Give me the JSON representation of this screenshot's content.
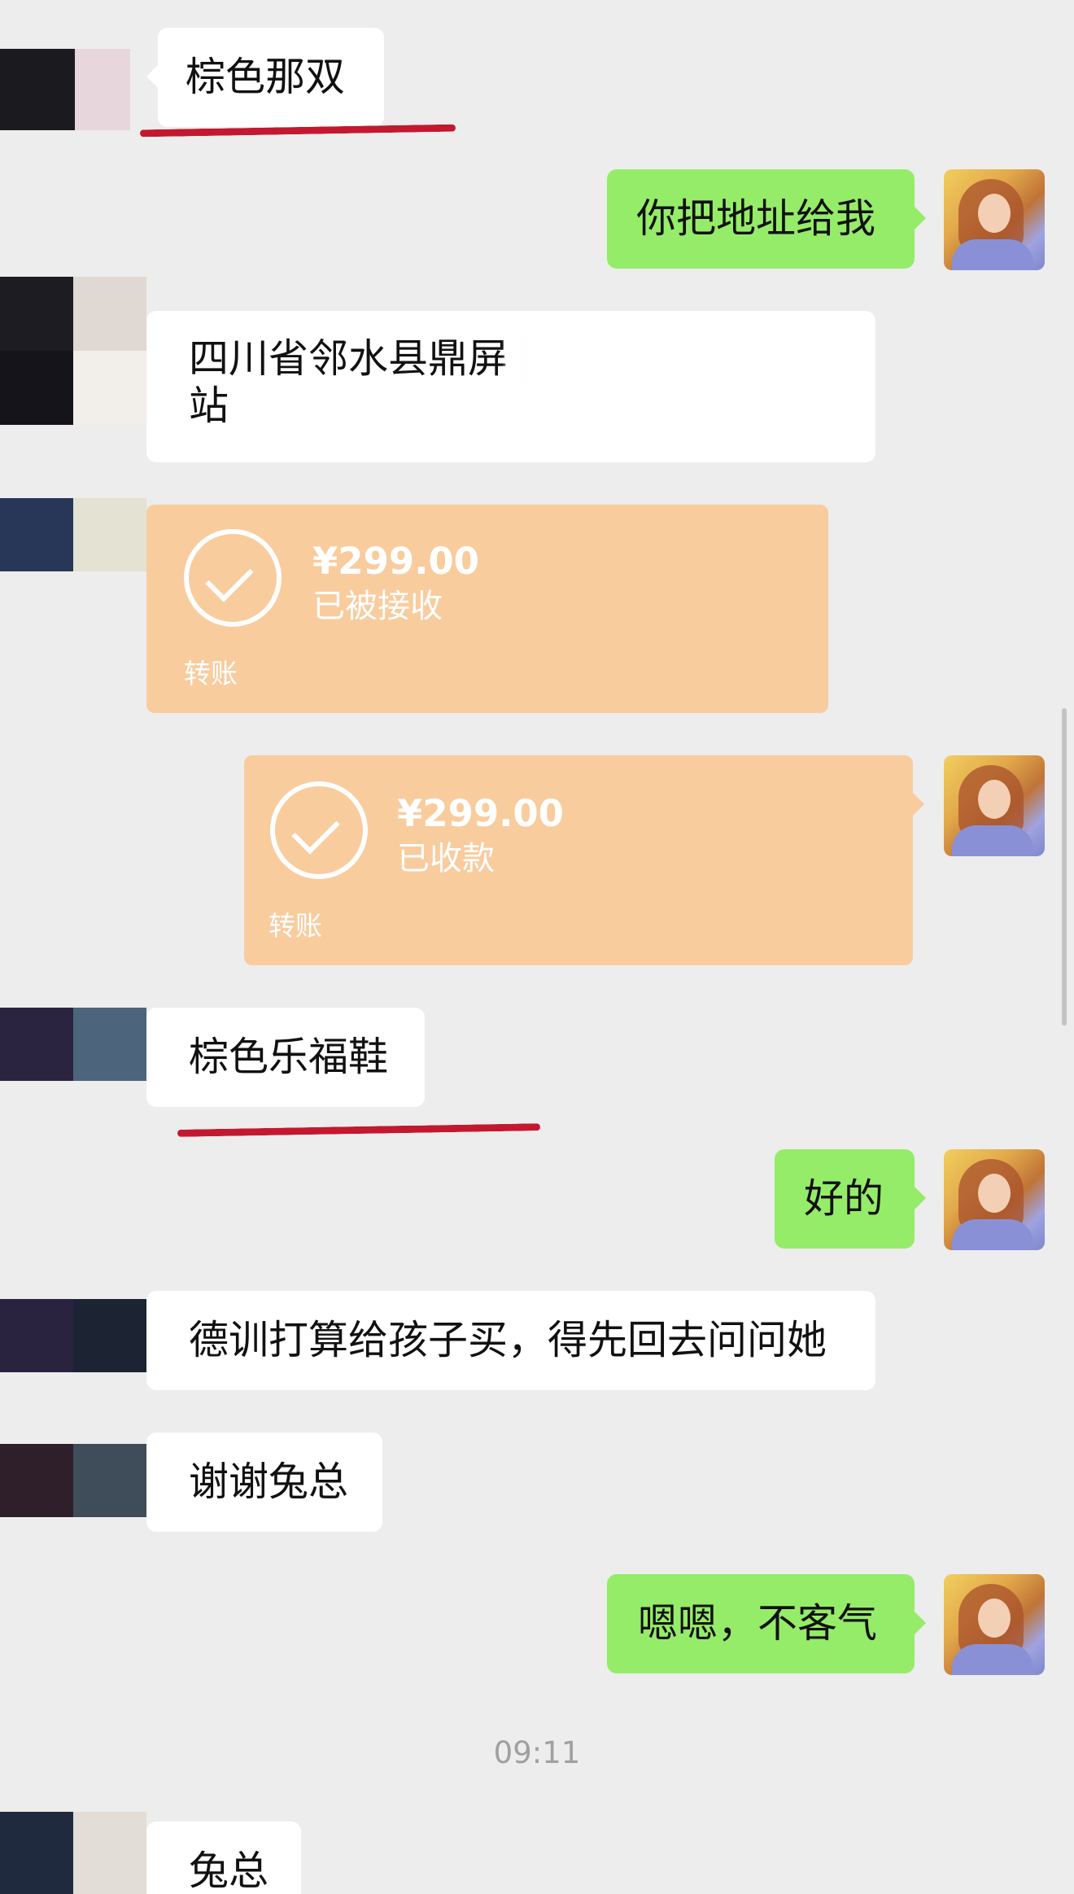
{
  "theme": {
    "background": "#ededed",
    "sent_bubble": "#95ec69",
    "received_bubble": "#ffffff",
    "transfer_card": "#f9cc9e",
    "underline": "#c3182f"
  },
  "messages": {
    "m1": "棕色那双",
    "m2": "你把地址给我",
    "m3_line1": "四川省邻水县鼎屏",
    "m3_line2": "站",
    "m6": "棕色乐福鞋",
    "m7": "好的",
    "m8": "德训打算给孩子买，得先回去问问她",
    "m9": "谢谢兔总",
    "m10": "嗯嗯，不客气",
    "m11": "兔总"
  },
  "transfers": {
    "received": {
      "amount": "¥299.00",
      "status": "已被接收",
      "label": "转账"
    },
    "sent": {
      "amount": "¥299.00",
      "status": "已收款",
      "label": "转账"
    }
  },
  "timestamp": "09:11",
  "icons": {
    "transfer_check": "check-circle-icon",
    "avatar_self": "avatar-photo"
  }
}
